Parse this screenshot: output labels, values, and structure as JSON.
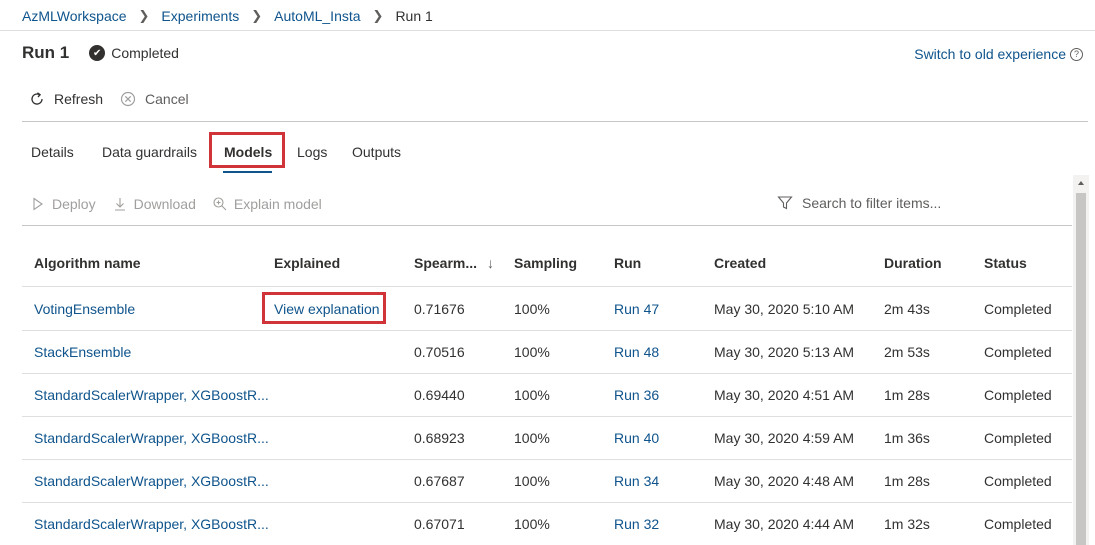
{
  "breadcrumb": [
    "AzMLWorkspace",
    "Experiments",
    "AutoML_Insta",
    "Run 1"
  ],
  "run": {
    "title": "Run 1",
    "status": "Completed"
  },
  "switch_link": "Switch to old experience",
  "toolbar": {
    "refresh": "Refresh",
    "cancel": "Cancel"
  },
  "tabs": [
    {
      "label": "Details"
    },
    {
      "label": "Data guardrails"
    },
    {
      "label": "Models"
    },
    {
      "label": "Logs"
    },
    {
      "label": "Outputs"
    }
  ],
  "active_tab": "Models",
  "actions": {
    "deploy": "Deploy",
    "download": "Download",
    "explain": "Explain model"
  },
  "filter": {
    "placeholder": "Search to filter items..."
  },
  "table": {
    "columns": {
      "algorithm": "Algorithm name",
      "explained": "Explained",
      "spearman": "Spearm...",
      "sampling": "Sampling",
      "run": "Run",
      "created": "Created",
      "duration": "Duration",
      "status": "Status"
    },
    "sort_indicator": "↓",
    "rows": [
      {
        "algorithm": "VotingEnsemble",
        "explained": "View explanation",
        "spearman": "0.71676",
        "sampling": "100%",
        "run": "Run 47",
        "created": "May 30, 2020 5:10 AM",
        "duration": "2m 43s",
        "status": "Completed"
      },
      {
        "algorithm": "StackEnsemble",
        "explained": "",
        "spearman": "0.70516",
        "sampling": "100%",
        "run": "Run 48",
        "created": "May 30, 2020 5:13 AM",
        "duration": "2m 53s",
        "status": "Completed"
      },
      {
        "algorithm": "StandardScalerWrapper, XGBoostR...",
        "explained": "",
        "spearman": "0.69440",
        "sampling": "100%",
        "run": "Run 36",
        "created": "May 30, 2020 4:51 AM",
        "duration": "1m 28s",
        "status": "Completed"
      },
      {
        "algorithm": "StandardScalerWrapper, XGBoostR...",
        "explained": "",
        "spearman": "0.68923",
        "sampling": "100%",
        "run": "Run 40",
        "created": "May 30, 2020 4:59 AM",
        "duration": "1m 36s",
        "status": "Completed"
      },
      {
        "algorithm": "StandardScalerWrapper, XGBoostR...",
        "explained": "",
        "spearman": "0.67687",
        "sampling": "100%",
        "run": "Run 34",
        "created": "May 30, 2020 4:48 AM",
        "duration": "1m 28s",
        "status": "Completed"
      },
      {
        "algorithm": "StandardScalerWrapper, XGBoostR...",
        "explained": "",
        "spearman": "0.67071",
        "sampling": "100%",
        "run": "Run 32",
        "created": "May 30, 2020 4:44 AM",
        "duration": "1m 32s",
        "status": "Completed"
      }
    ]
  },
  "colors": {
    "link": "#0f548c",
    "highlight": "#d13438",
    "text": "#323130"
  },
  "icons": {
    "status": "check-circle-icon",
    "help": "help-circle-icon",
    "refresh": "refresh-icon",
    "cancel": "cancel-icon",
    "deploy": "play-icon",
    "download": "download-icon",
    "explain": "explain-icon",
    "filter": "filter-icon",
    "sort": "sort-desc-icon"
  }
}
